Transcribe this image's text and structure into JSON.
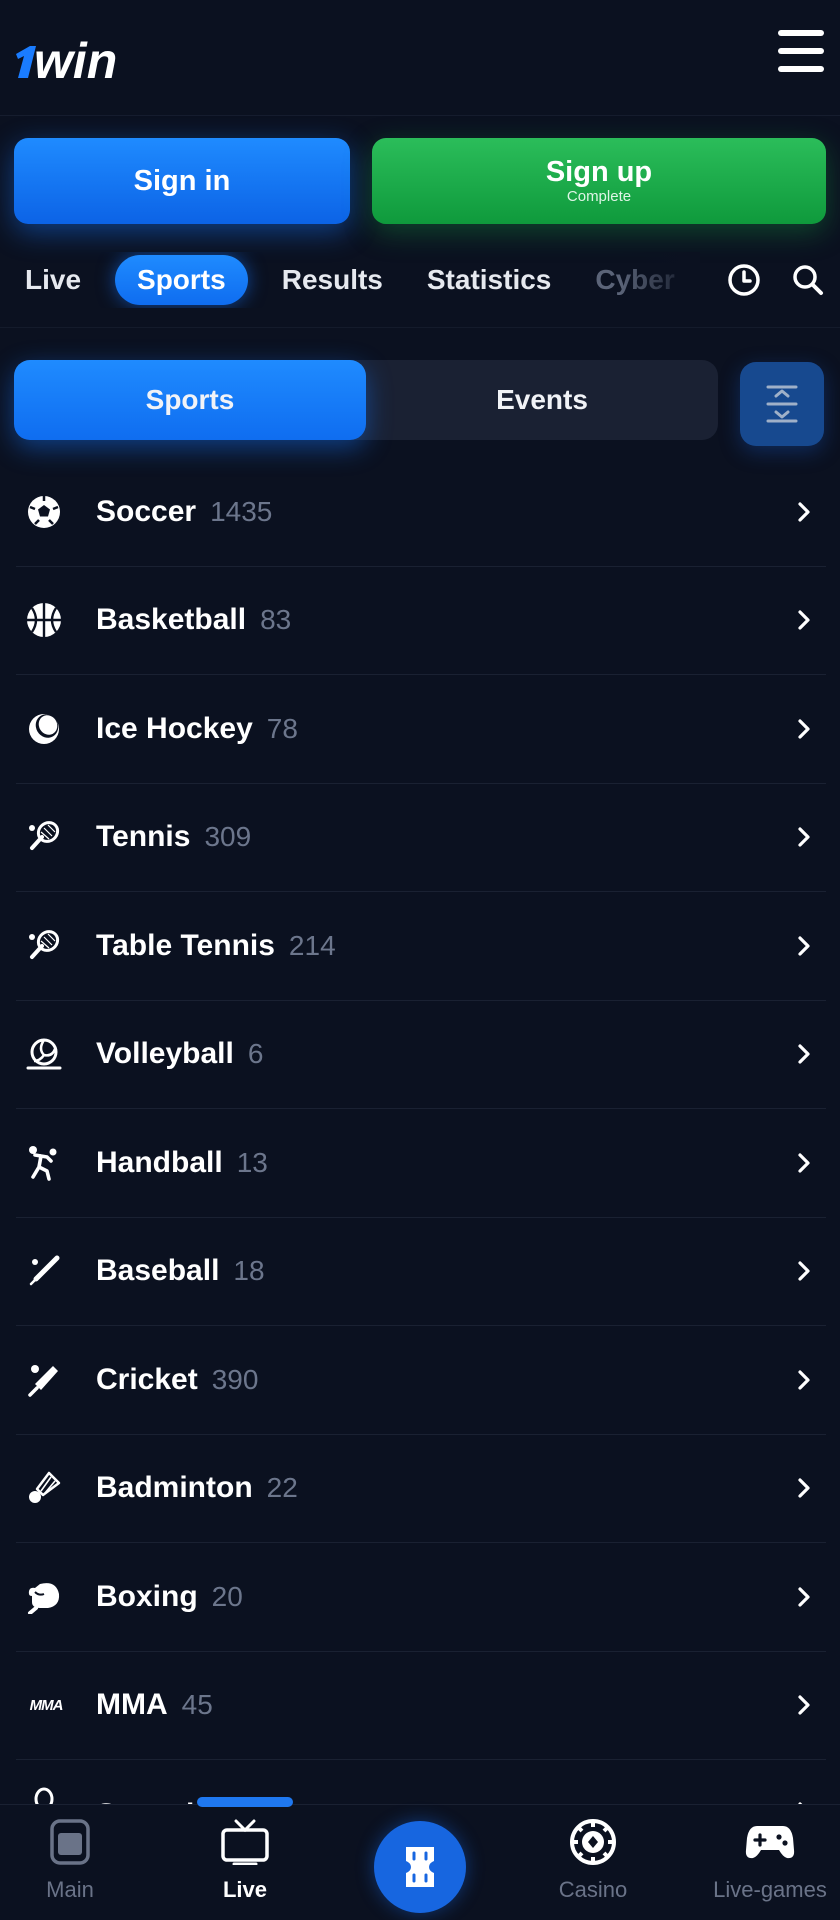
{
  "header": {
    "logo_text": "1win",
    "menu_icon": "hamburger-menu-icon"
  },
  "auth": {
    "signin_label": "Sign in",
    "signup_label": "Sign up",
    "signup_sublabel": "Complete"
  },
  "topnav": {
    "tabs": [
      {
        "label": "Live",
        "active": false
      },
      {
        "label": "Sports",
        "active": true
      },
      {
        "label": "Results",
        "active": false
      },
      {
        "label": "Statistics",
        "active": false
      },
      {
        "label": "Cyber",
        "active": false
      }
    ],
    "icons": [
      "clock-icon",
      "search-icon"
    ]
  },
  "segment": {
    "options": [
      {
        "label": "Sports",
        "active": true
      },
      {
        "label": "Events",
        "active": false
      }
    ],
    "collapse_icon": "collapse-all-icon"
  },
  "sports": [
    {
      "name": "Soccer",
      "count": "1435",
      "icon": "soccer-ball-icon"
    },
    {
      "name": "Basketball",
      "count": "83",
      "icon": "basketball-icon"
    },
    {
      "name": "Ice Hockey",
      "count": "78",
      "icon": "hockey-puck-icon"
    },
    {
      "name": "Tennis",
      "count": "309",
      "icon": "tennis-racket-icon"
    },
    {
      "name": "Table Tennis",
      "count": "214",
      "icon": "table-tennis-icon"
    },
    {
      "name": "Volleyball",
      "count": "6",
      "icon": "volleyball-icon"
    },
    {
      "name": "Handball",
      "count": "13",
      "icon": "handball-icon"
    },
    {
      "name": "Baseball",
      "count": "18",
      "icon": "baseball-bat-icon"
    },
    {
      "name": "Cricket",
      "count": "390",
      "icon": "cricket-bat-icon"
    },
    {
      "name": "Badminton",
      "count": "22",
      "icon": "shuttlecock-icon"
    },
    {
      "name": "Boxing",
      "count": "20",
      "icon": "boxing-glove-icon"
    },
    {
      "name": "MMA",
      "count": "45",
      "icon": "mma-icon",
      "icon_text": "MMA"
    },
    {
      "name": "Squash",
      "count": "",
      "icon": "squash-icon"
    }
  ],
  "bottomnav": {
    "items": [
      {
        "label": "Main",
        "icon": "main-icon",
        "active": false
      },
      {
        "label": "Live",
        "icon": "tv-icon",
        "active": true
      },
      {
        "label": "",
        "icon": "bet-slip-icon",
        "active": false
      },
      {
        "label": "Casino",
        "icon": "casino-chip-icon",
        "active": false
      },
      {
        "label": "Live-games",
        "icon": "gamepad-icon",
        "active": false
      }
    ]
  },
  "colors": {
    "background": "#0b1120",
    "accent_blue": "#1677ff",
    "accent_green": "#1ea84a",
    "muted_text": "#6c768c"
  }
}
